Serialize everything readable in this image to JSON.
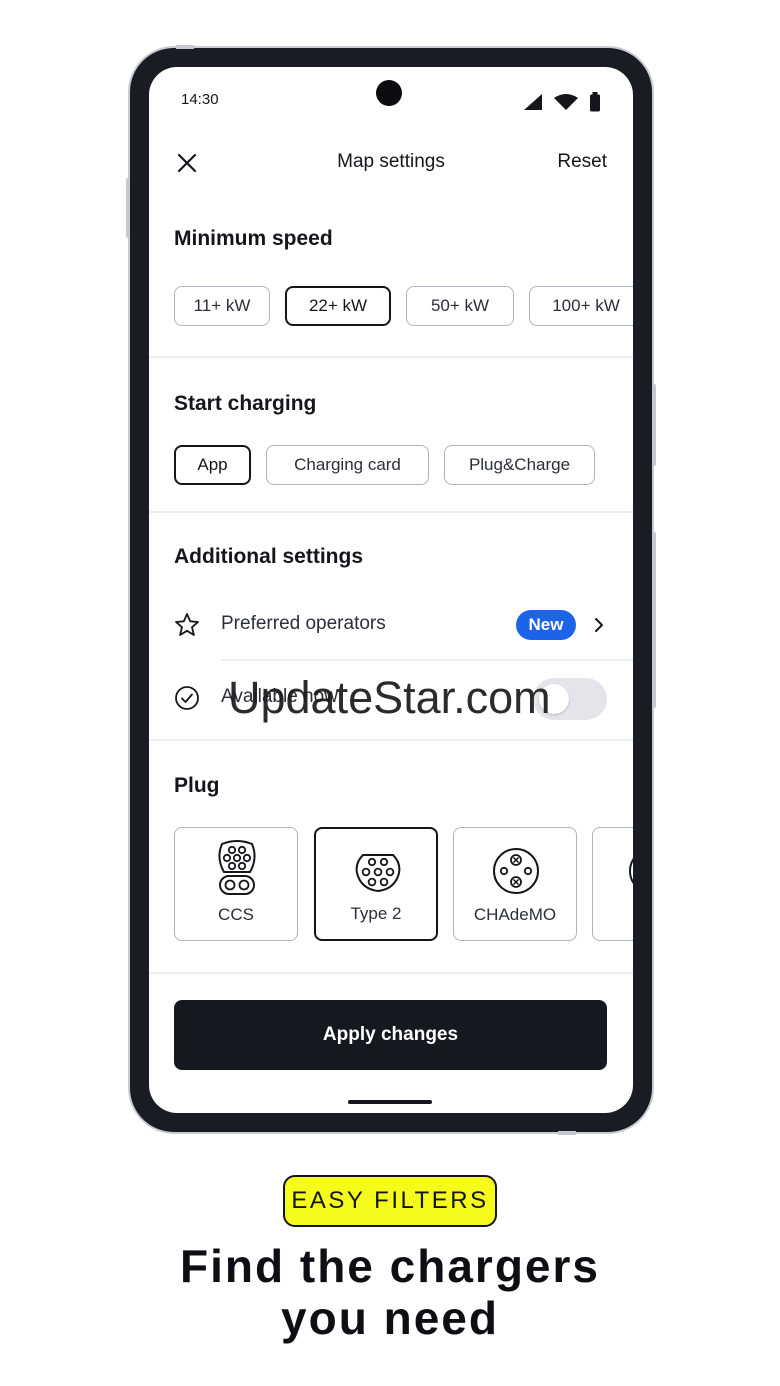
{
  "status_bar": {
    "time": "14:30"
  },
  "header": {
    "title": "Map settings",
    "reset_label": "Reset"
  },
  "minimum_speed": {
    "title": "Minimum speed",
    "options": [
      "11+ kW",
      "22+ kW",
      "50+ kW",
      "100+ kW"
    ],
    "selected": "22+ kW"
  },
  "start_charging": {
    "title": "Start charging",
    "options": [
      "App",
      "Charging card",
      "Plug&Charge"
    ],
    "selected": "App"
  },
  "additional_settings": {
    "title": "Additional settings",
    "preferred_operators": {
      "label": "Preferred operators",
      "badge": "New"
    },
    "available_now": {
      "label": "Available now",
      "enabled": false
    }
  },
  "plug": {
    "title": "Plug",
    "options": [
      "CCS",
      "Type 2",
      "CHAdeMO"
    ],
    "selected": "Type 2"
  },
  "apply_label": "Apply changes",
  "watermark": "UpdateStar.com",
  "promo": {
    "tag": "EASY FILTERS",
    "headline_line1": "Find the chargers",
    "headline_line2": "you need"
  },
  "colors": {
    "accent_blue": "#1c63e8",
    "tag_yellow": "#f5fb1a",
    "button_dark": "#161820"
  }
}
